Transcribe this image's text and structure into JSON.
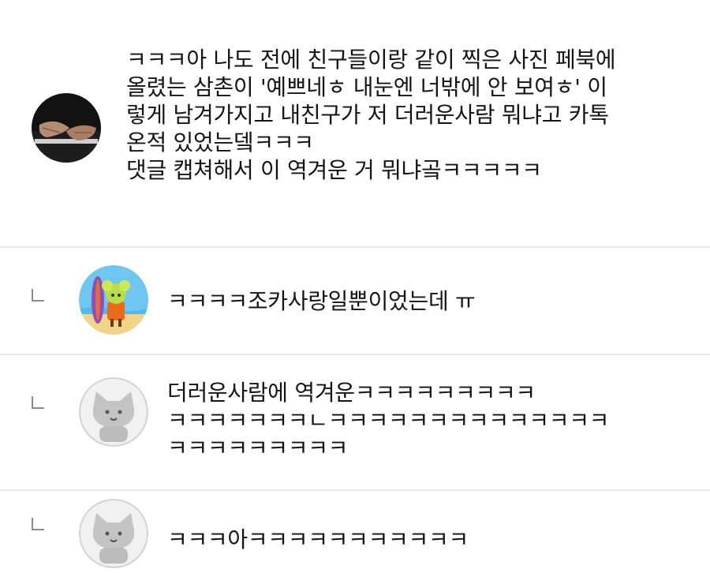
{
  "comments": [
    {
      "type": "comment",
      "avatar": "piano-hands-photo",
      "lines": [
        "ㅋㅋㅋ아 나도 전에 친구들이랑 같이 찍은 사진 페북에",
        "올렸는 삼촌이 '예쁘네ㅎ 내눈엔 너밖에 안 보여ㅎ' 이",
        "렇게 남겨가지고 내친구가 저 더러운사람 뭐냐고 카톡",
        "온적 있었는뎈ㅋㅋㅋ",
        "댓글 캡쳐해서 이 역겨운 거 뭐냐곸ㅋㅋㅋㅋㅋ"
      ]
    },
    {
      "type": "reply",
      "avatar": "surfer-character-icon",
      "lines": [
        "ㅋㅋㅋㅋ조카사랑일뿐이었는데 ㅠ"
      ]
    },
    {
      "type": "reply",
      "avatar": "default-cat-icon",
      "lines": [
        "더러운사람에 역겨운ㅋㅋㅋㅋㅋㅋㅋㅋㅋ",
        "ㅋㅋㅋㅋㅋㅋㅋㄴㅋㅋㅋㅋㅋㅋㅋㅋㅋㅋㅋㅋㅋㅋ",
        "ㅋㅋㅋㅋㅋㅋㅋㅋㅋ"
      ]
    },
    {
      "type": "reply",
      "avatar": "default-cat-icon",
      "lines": [
        "ㅋㅋㅋ아ㅋㅋㅋㅋㅋㅋㅋㅋㅋㅋㅋ"
      ]
    }
  ]
}
